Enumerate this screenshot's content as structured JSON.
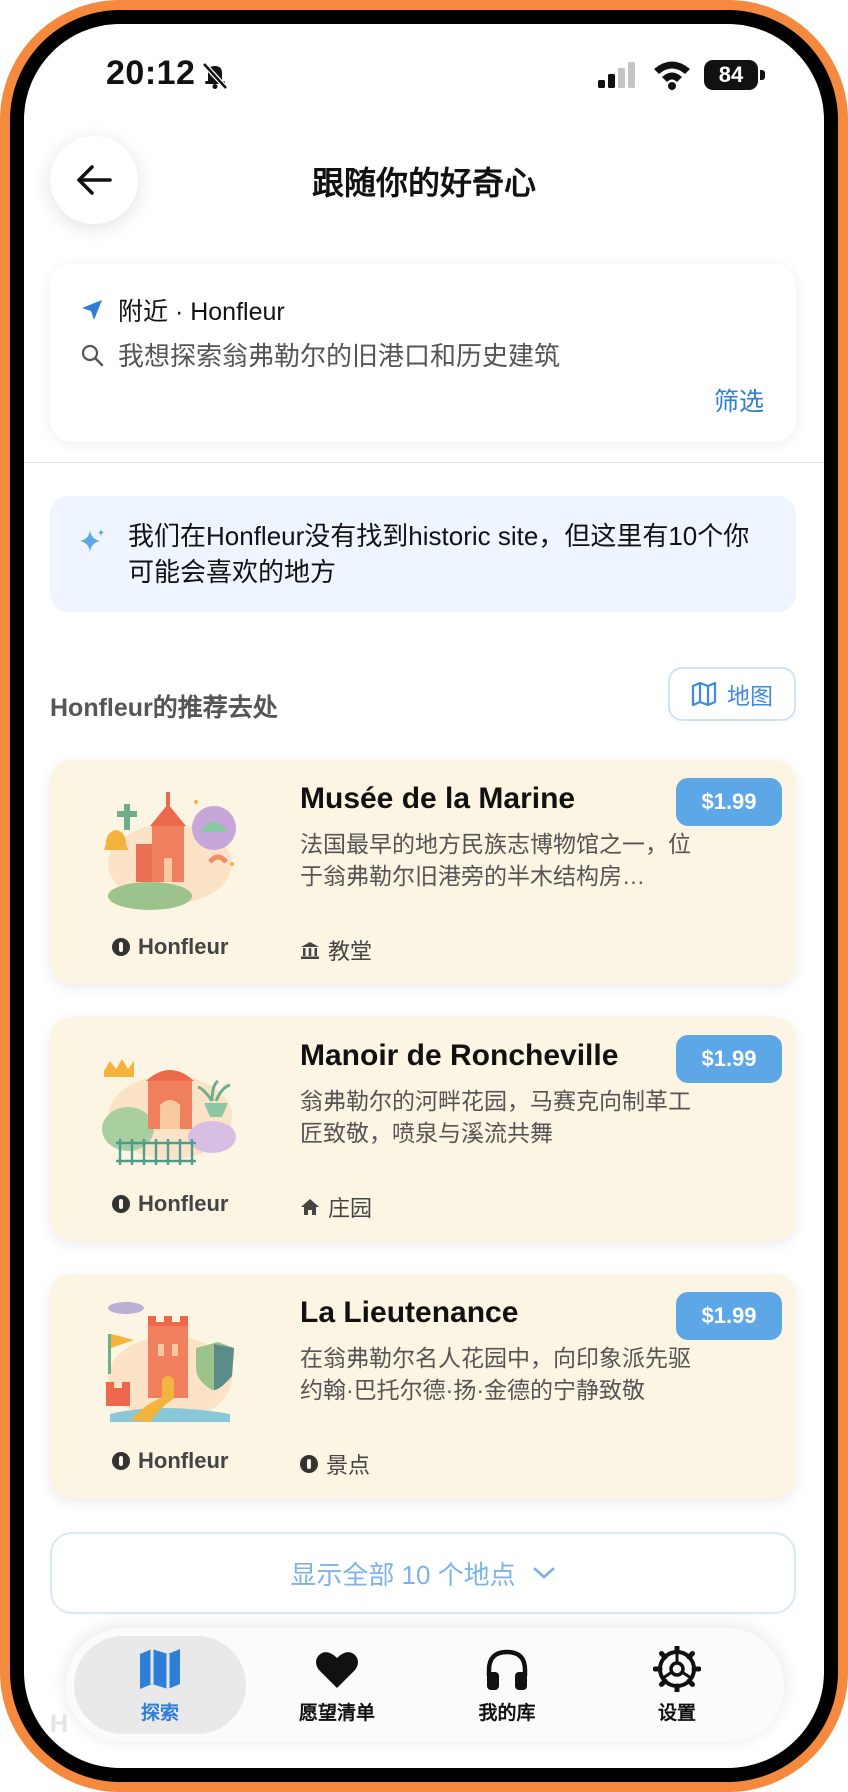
{
  "status_bar": {
    "time": "20:12",
    "battery": "84"
  },
  "header": {
    "title": "跟随你的好奇心"
  },
  "search": {
    "location_label": "附近 · Honfleur",
    "query": "我想探索翁弗勒尔的旧港口和历史建筑",
    "filter_label": "筛选"
  },
  "notice": {
    "text": "我们在Honfleur没有找到historic site，但这里有10个你可能会喜欢的地方"
  },
  "section": {
    "title": "Honfleur的推荐去处",
    "map_label": "地图"
  },
  "places": [
    {
      "name": "Musée de la Marine",
      "description": "法国最早的地方民族志博物馆之一，位于翁弗勒尔旧港旁的半木结构房…",
      "city": "Honfleur",
      "category": "教堂",
      "price": "$1.99",
      "category_icon": "museum-icon"
    },
    {
      "name": "Manoir de Roncheville",
      "description": "翁弗勒尔的河畔花园，马赛克向制革工匠致敬，喷泉与溪流共舞",
      "city": "Honfleur",
      "category": "庄园",
      "price": "$1.99",
      "category_icon": "home-icon"
    },
    {
      "name": "La Lieutenance",
      "description": "在翁弗勒尔名人花园中，向印象派先驱约翰·巴托尔德·扬·金德的宁静致敬",
      "city": "Honfleur",
      "category": "景点",
      "price": "$1.99",
      "category_icon": "pin-icon"
    }
  ],
  "show_all": {
    "label": "显示全部 10 个地点"
  },
  "tabs": [
    {
      "label": "探索",
      "icon": "map-icon",
      "active": true
    },
    {
      "label": "愿望清单",
      "icon": "heart-icon",
      "active": false
    },
    {
      "label": "我的库",
      "icon": "headphones-icon",
      "active": false
    },
    {
      "label": "设置",
      "icon": "gear-icon",
      "active": false
    }
  ],
  "colors": {
    "frame": "#F58A3F",
    "accent": "#2F7FD8",
    "price_badge": "#5EA7E6",
    "card_bg": "#FDF5E3",
    "notice_bg": "#EEF5FE"
  }
}
